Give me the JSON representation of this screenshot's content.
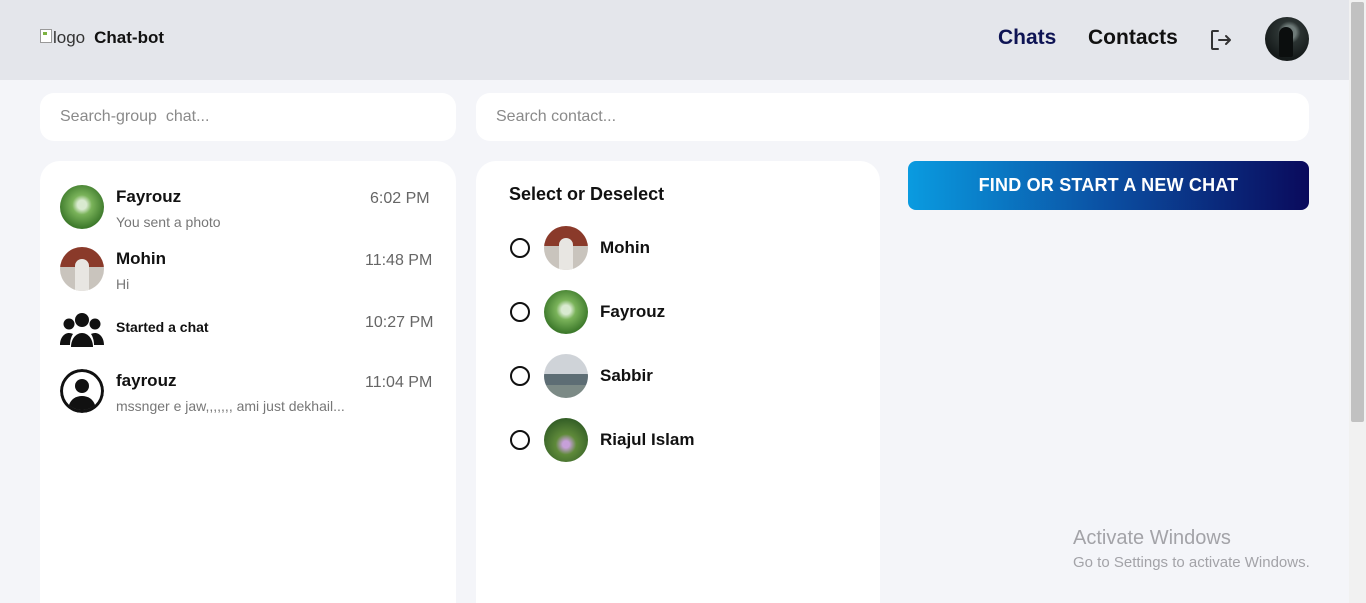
{
  "header": {
    "logo_alt": "logo",
    "app_title": "Chat-bot",
    "nav": {
      "chats": "Chats",
      "contacts": "Contacts"
    },
    "logout_icon": "logout-icon",
    "active_color": "#0e1454"
  },
  "search": {
    "group_placeholder": "Search-group  chat...",
    "contact_placeholder": "Search contact..."
  },
  "chats": [
    {
      "name": "Fayrouz",
      "last_message": "You sent a photo",
      "time": "6:02 PM"
    },
    {
      "name": "Mohin",
      "last_message": "Hi",
      "time": "11:48 PM"
    },
    {
      "label": "Started a chat",
      "time": "10:27 PM",
      "icon": "group-icon"
    },
    {
      "name": "fayrouz",
      "last_message": "mssnger e jaw,,,,,,, ami just dekhail...",
      "time": "11:04 PM",
      "icon": "user-circle-icon"
    }
  ],
  "contacts": {
    "title": "Select or Deselect",
    "items": [
      {
        "name": "Mohin",
        "selected": false
      },
      {
        "name": "Fayrouz",
        "selected": false
      },
      {
        "name": "Sabbir",
        "selected": false
      },
      {
        "name": "Riajul Islam",
        "selected": false
      }
    ]
  },
  "cta": {
    "label": "FIND OR START A NEW CHAT",
    "gradient": [
      "#0a9be0",
      "#0a0a5c"
    ]
  },
  "watermark": {
    "line1": "Activate Windows",
    "line2": "Go to Settings to activate Windows."
  }
}
